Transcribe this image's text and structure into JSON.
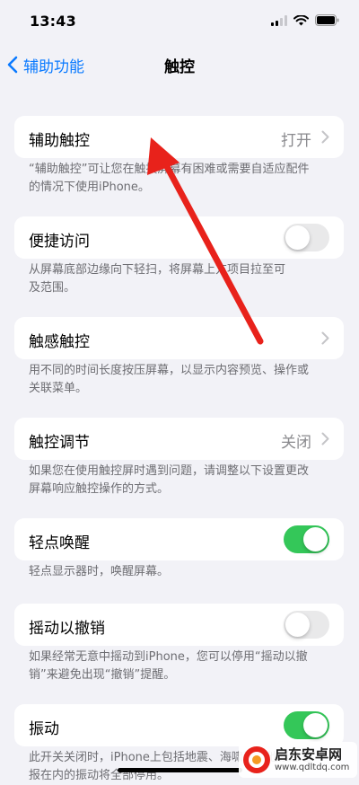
{
  "status_bar": {
    "time": "13:43"
  },
  "nav": {
    "back_label": "辅助功能",
    "title": "触控"
  },
  "settings": [
    {
      "label": "辅助触控",
      "value": "打开",
      "control": "chevron",
      "footnote": [
        "“辅助触控”可让您在触摸屏幕有困难或需要自适应配件",
        "的情况下使用iPhone。"
      ]
    },
    {
      "label": "便捷访问",
      "control": "toggle",
      "on": false,
      "footnote": [
        "从屏幕底部边缘向下轻扫，将屏幕上方项目拉至可",
        "及范围。"
      ]
    },
    {
      "label": "触感触控",
      "control": "chevron",
      "footnote": [
        "用不同的时间长度按压屏幕，以显示内容预览、操作或",
        "关联菜单。"
      ]
    },
    {
      "label": "触控调节",
      "value": "关闭",
      "control": "chevron",
      "footnote": [
        "如果您在使用触控屏时遇到问题，请调整以下设置更改",
        "屏幕响应触控操作的方式。"
      ]
    },
    {
      "label": "轻点唤醒",
      "control": "toggle",
      "on": true,
      "footnote": [
        "轻点显示器时，唤醒屏幕。"
      ]
    },
    {
      "label": "摇动以撤销",
      "control": "toggle",
      "on": false,
      "footnote": [
        "如果经常无意中摇动到iPhone，您可以停用“摇动以撤",
        "销”来避免出现“撤销”提醒。"
      ]
    },
    {
      "label": "振动",
      "control": "toggle",
      "on": true,
      "footnote": [
        "此开关关闭时，iPhone上包括地震、海啸和其他紧急警",
        "报在内的振动将全部停用。"
      ]
    }
  ],
  "colors": {
    "accent": "#0a7aff",
    "toggle_on": "#34c759",
    "annotation_arrow": "#e8221b"
  },
  "watermark": {
    "title": "启东安卓网",
    "url": "www.qdltdq.com"
  }
}
